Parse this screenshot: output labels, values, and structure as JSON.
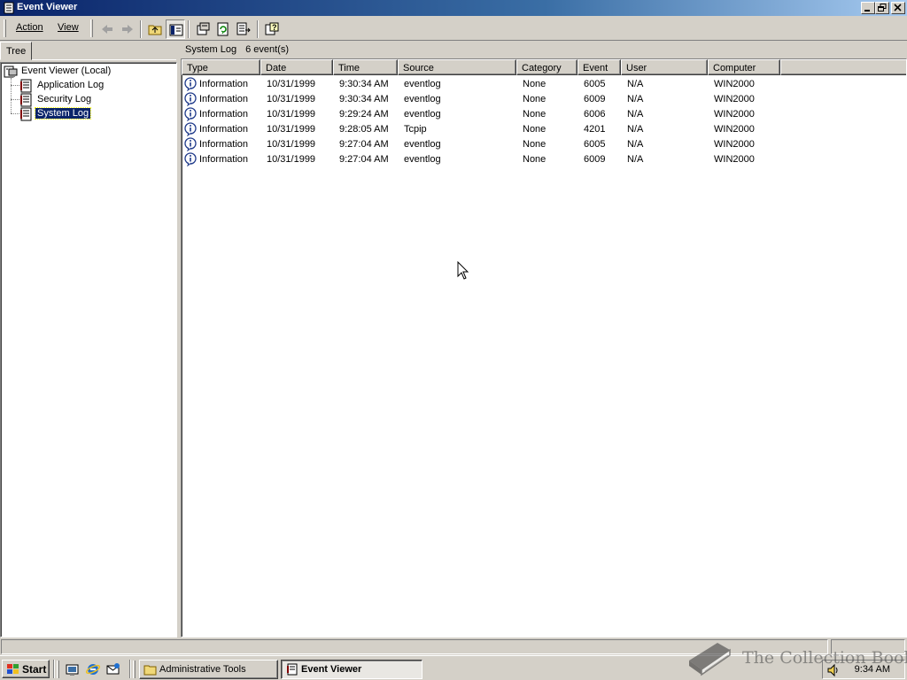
{
  "window": {
    "title": "Event Viewer"
  },
  "menu": {
    "action": "Action",
    "view": "View"
  },
  "tree": {
    "tab_label": "Tree",
    "root": "Event Viewer (Local)",
    "items": [
      "Application Log",
      "Security Log",
      "System Log"
    ],
    "selected": "System Log"
  },
  "pane": {
    "title": "System Log",
    "count": "6 event(s)"
  },
  "columns": [
    "Type",
    "Date",
    "Time",
    "Source",
    "Category",
    "Event",
    "User",
    "Computer"
  ],
  "rows": [
    {
      "type": "Information",
      "date": "10/31/1999",
      "time": "9:30:34 AM",
      "source": "eventlog",
      "category": "None",
      "event": "6005",
      "user": "N/A",
      "computer": "WIN2000"
    },
    {
      "type": "Information",
      "date": "10/31/1999",
      "time": "9:30:34 AM",
      "source": "eventlog",
      "category": "None",
      "event": "6009",
      "user": "N/A",
      "computer": "WIN2000"
    },
    {
      "type": "Information",
      "date": "10/31/1999",
      "time": "9:29:24 AM",
      "source": "eventlog",
      "category": "None",
      "event": "6006",
      "user": "N/A",
      "computer": "WIN2000"
    },
    {
      "type": "Information",
      "date": "10/31/1999",
      "time": "9:28:05 AM",
      "source": "Tcpip",
      "category": "None",
      "event": "4201",
      "user": "N/A",
      "computer": "WIN2000"
    },
    {
      "type": "Information",
      "date": "10/31/1999",
      "time": "9:27:04 AM",
      "source": "eventlog",
      "category": "None",
      "event": "6005",
      "user": "N/A",
      "computer": "WIN2000"
    },
    {
      "type": "Information",
      "date": "10/31/1999",
      "time": "9:27:04 AM",
      "source": "eventlog",
      "category": "None",
      "event": "6009",
      "user": "N/A",
      "computer": "WIN2000"
    }
  ],
  "taskbar": {
    "start": "Start",
    "tasks": [
      "Administrative Tools",
      "Event Viewer"
    ],
    "active_task": "Event Viewer",
    "clock": "9:34 AM"
  },
  "watermark": "The Collection Book",
  "icons": {
    "toolbar": [
      "back-arrow-icon",
      "forward-arrow-icon",
      "up-folder-icon",
      "show-hide-tree-icon",
      "properties-icon",
      "refresh-icon",
      "export-list-icon",
      "help-icon"
    ],
    "row": "information-icon"
  },
  "colors": {
    "title_start": "#0a246a",
    "title_end": "#a6caf0",
    "selection": "#0a246a",
    "face": "#d4d0c8"
  }
}
